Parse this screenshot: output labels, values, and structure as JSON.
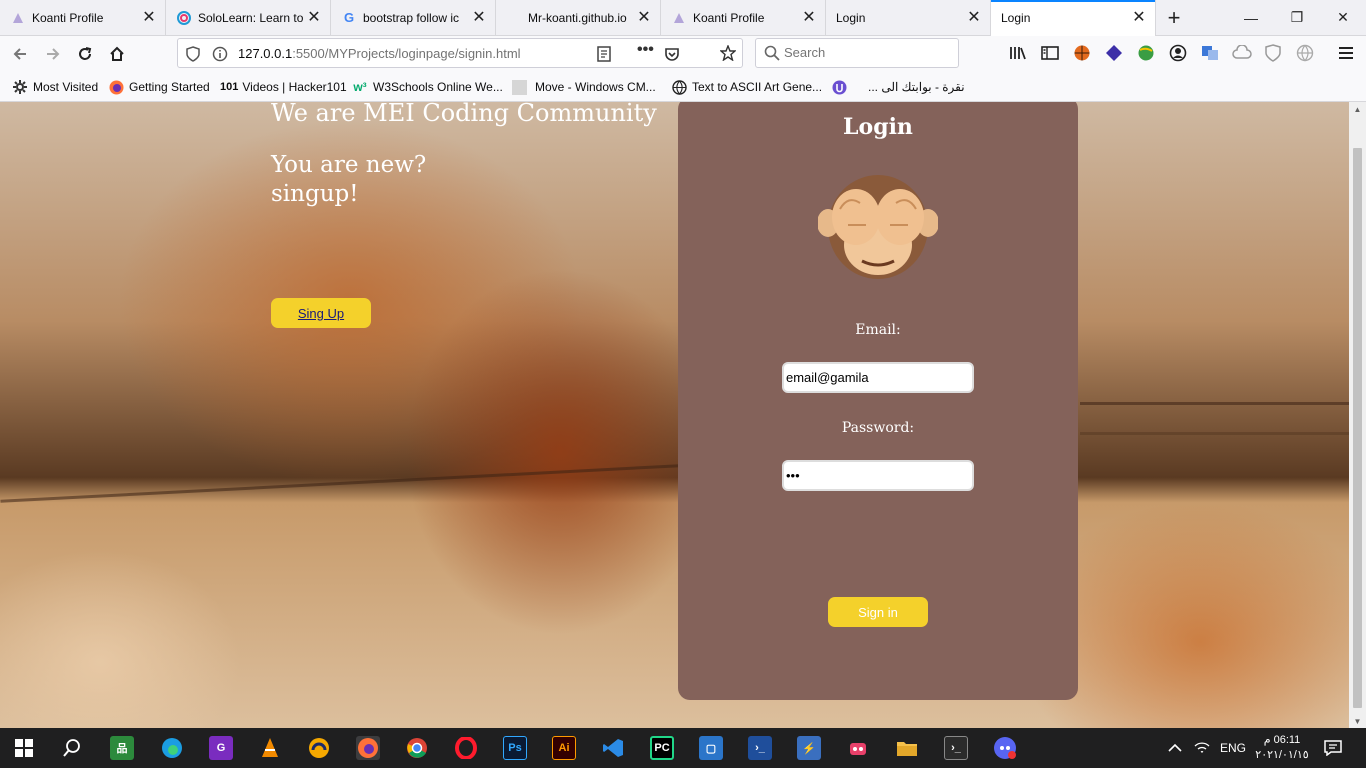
{
  "browser": {
    "tabs": [
      {
        "title": "Koanti Profile",
        "icon": "koanti-icon",
        "active": false
      },
      {
        "title": "SoloLearn: Learn to",
        "icon": "sololearn-icon",
        "active": false
      },
      {
        "title": "bootstrap follow ic",
        "icon": "google-icon",
        "active": false
      },
      {
        "title": "Mr-koanti.github.io",
        "icon": "blank-page-icon",
        "active": false
      },
      {
        "title": "Koanti Profile",
        "icon": "koanti-icon",
        "active": false
      },
      {
        "title": "Login",
        "icon": "blank-page-icon",
        "active": false
      },
      {
        "title": "Login",
        "icon": "blank-page-icon",
        "active": true
      }
    ],
    "url_host": "127.0.0.1",
    "url_rest": ":5500/MYProjects/loginpage/signin.html",
    "search_placeholder": "Search",
    "bookmarks": [
      {
        "label": "Most Visited",
        "icon": "gear-icon"
      },
      {
        "label": "Getting Started",
        "icon": "firefox-icon"
      },
      {
        "label": "Videos | Hacker101",
        "icon": "hacker101-icon",
        "prefix": "101"
      },
      {
        "label": "W3Schools Online We...",
        "icon": "w3schools-icon"
      },
      {
        "label": "Move - Windows CM...",
        "icon": "page-icon"
      },
      {
        "label": "Text to ASCII Art Gene...",
        "icon": "globe-icon"
      },
      {
        "label": "",
        "icon": "ublock-icon"
      },
      {
        "label": "نقرة - بوابتك الى ...",
        "icon": "none"
      }
    ]
  },
  "page": {
    "heading": "We are MEI Coding Community",
    "new_line1": "You are new?",
    "new_line2": "singup!",
    "signup_button": "Sing Up",
    "login": {
      "title": "Login",
      "email_label": "Email:",
      "email_value": "email@gamila",
      "password_label": "Password:",
      "password_value": "abc",
      "signin_button": "Sign in"
    }
  },
  "taskbar": {
    "language": "ENG",
    "time": "06:11 م",
    "date": "٢٠٢١/٠١/١٥"
  },
  "colors": {
    "login_panel": "#84625a",
    "button_yellow": "#f4d12b"
  }
}
